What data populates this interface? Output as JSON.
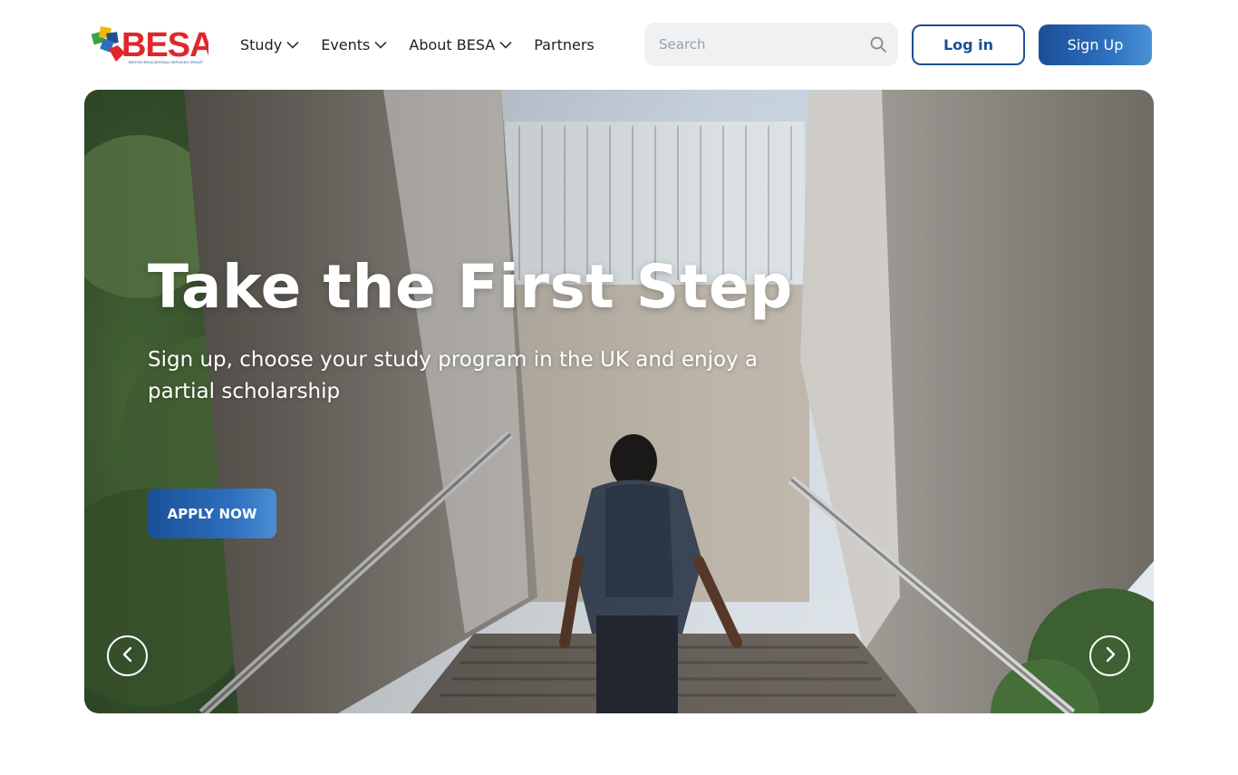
{
  "brand": {
    "name": "BESA",
    "tagline": "BRITISH EDUCATIONAL SERVICES GROUP",
    "colors": {
      "red": "#e0262b",
      "blue": "#1d4f93",
      "green": "#3aa346",
      "yellow": "#f5b800"
    }
  },
  "nav": {
    "items": [
      {
        "label": "Study",
        "has_dropdown": true
      },
      {
        "label": "Events",
        "has_dropdown": true
      },
      {
        "label": "About BESA",
        "has_dropdown": true
      },
      {
        "label": "Partners",
        "has_dropdown": false
      }
    ]
  },
  "search": {
    "placeholder": "Search",
    "icon": "search-icon"
  },
  "auth": {
    "login_label": "Log in",
    "signup_label": "Sign Up"
  },
  "hero": {
    "title": "Take the First Step",
    "subtitle": "Sign up, choose your study program in the UK and enjoy a partial scholarship",
    "cta_label": "APPLY NOW",
    "prev_icon": "chevron-left-icon",
    "next_icon": "chevron-right-icon"
  },
  "colors": {
    "accent": "#1d4f93",
    "accent_light": "#4a92d6",
    "search_bg": "#eff1f3"
  }
}
